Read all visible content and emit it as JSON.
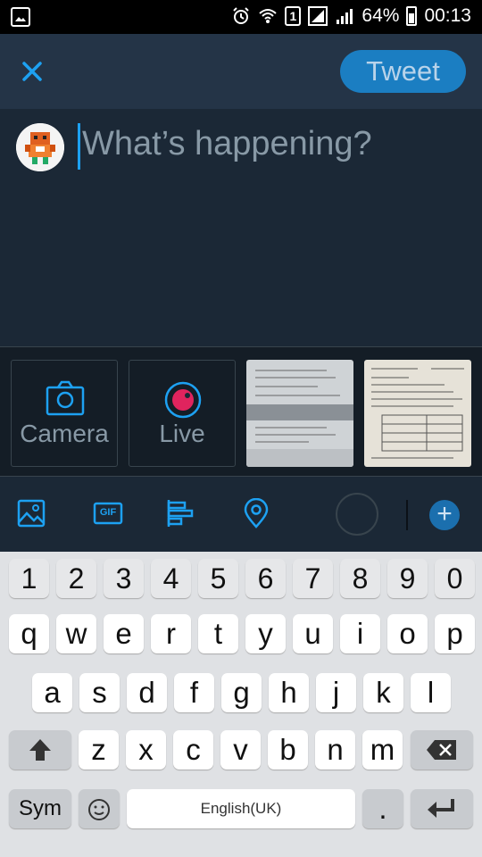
{
  "status_bar": {
    "battery": "64%",
    "time": "00:13",
    "sim_slot": "1"
  },
  "header": {
    "tweet_label": "Tweet"
  },
  "compose": {
    "placeholder": "What’s happening?"
  },
  "media": {
    "camera_label": "Camera",
    "live_label": "Live"
  },
  "toolbar": {
    "icons": [
      "image-icon",
      "gif-icon",
      "poll-icon",
      "location-icon"
    ],
    "gif_text": "GIF"
  },
  "keyboard": {
    "row_numbers": [
      "1",
      "2",
      "3",
      "4",
      "5",
      "6",
      "7",
      "8",
      "9",
      "0"
    ],
    "row_1": [
      "q",
      "w",
      "e",
      "r",
      "t",
      "y",
      "u",
      "i",
      "o",
      "p"
    ],
    "row_2": [
      "a",
      "s",
      "d",
      "f",
      "g",
      "h",
      "j",
      "k",
      "l"
    ],
    "row_3": [
      "z",
      "x",
      "c",
      "v",
      "b",
      "n",
      "m"
    ],
    "sym_label": "Sym",
    "space_label": "English(UK)",
    "period_label": "."
  },
  "colors": {
    "accent": "#1da1f2",
    "tweet_button": "#1b7ec2",
    "background": "#1b2836",
    "header": "#243447",
    "live_red": "#e0245e"
  }
}
